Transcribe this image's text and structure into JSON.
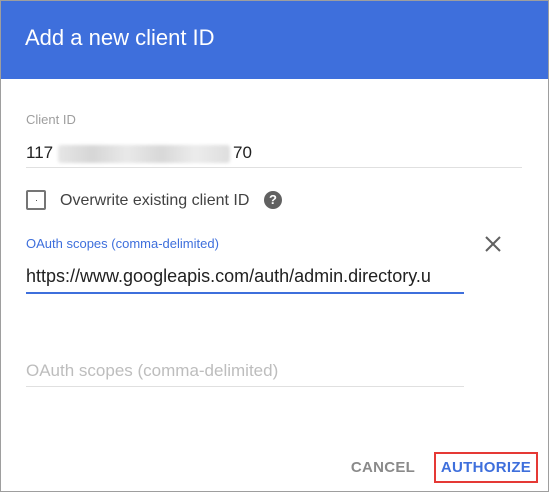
{
  "dialog": {
    "title": "Add a new client ID"
  },
  "client_id": {
    "label": "Client ID",
    "value_prefix": "117",
    "value_suffix": "70"
  },
  "overwrite": {
    "label": "Overwrite existing client ID",
    "checked": false,
    "help_icon": "help-icon",
    "help_glyph": "?"
  },
  "scopes": {
    "active_label": "OAuth scopes (comma-delimited)",
    "active_value": "https://www.googleapis.com/auth/admin.directory.u",
    "clear_icon": "close-icon",
    "empty_placeholder": "OAuth scopes (comma-delimited)"
  },
  "actions": {
    "cancel_label": "CANCEL",
    "authorize_label": "AUTHORIZE"
  },
  "colors": {
    "header": "#3e6fdc",
    "accent": "#3e6fdc",
    "highlight_border": "#e53935"
  }
}
